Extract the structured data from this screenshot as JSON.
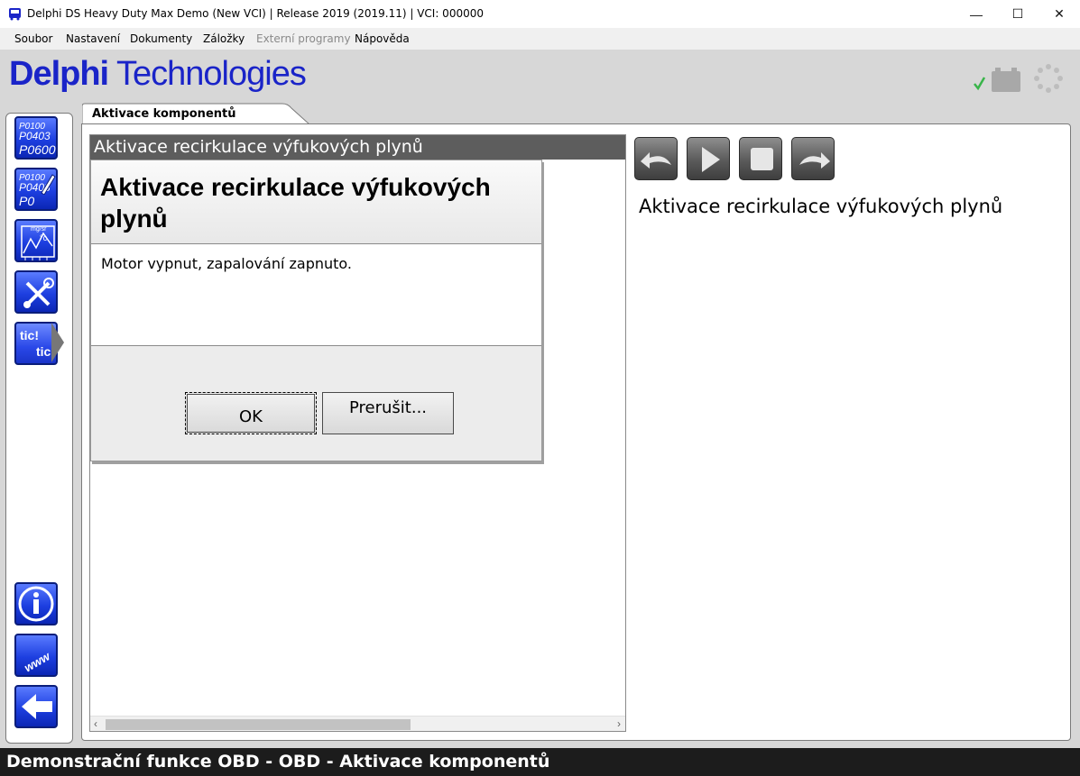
{
  "window": {
    "title": "Delphi DS Heavy Duty Max Demo (New VCI) | Release 2019 (2019.11)  |  VCI: 000000",
    "minimize_glyph": "—",
    "maximize_glyph": "☐",
    "close_glyph": "✕"
  },
  "menu": {
    "items": [
      "Soubor",
      "Nastavení",
      "Dokumenty",
      "Záložky",
      "Externí programy",
      "Nápověda"
    ]
  },
  "header": {
    "logo_part1": "Delphi",
    "logo_part2": "Technologies",
    "brand_color": "#1a24c8",
    "status_icons": [
      "checkmark-icon",
      "battery-icon",
      "loading-spinner-icon"
    ]
  },
  "sidebar": {
    "items": [
      {
        "name": "dtc-read",
        "lines": [
          "P0100",
          "P0403",
          "P0600"
        ]
      },
      {
        "name": "dtc-erase",
        "lines": [
          "P0100",
          "P0403",
          "P0"
        ]
      },
      {
        "name": "live-data",
        "lines": [
          "mg/sr",
          "°c"
        ]
      },
      {
        "name": "service-tools",
        "lines": []
      },
      {
        "name": "component-activation",
        "lines": [
          "tic!",
          "tic!"
        ]
      }
    ],
    "bottom_items": [
      "info",
      "www",
      "back"
    ]
  },
  "tab": {
    "label": "Aktivace komponentů"
  },
  "left_pane": {
    "header": "Aktivace recirkulace výfukových plynů"
  },
  "dialog": {
    "title": "Aktivace recirkulace výfukových plynů",
    "message": "Motor vypnut, zapalování zapnuto.",
    "ok_label": "OK",
    "abort_label": "Prerušit..."
  },
  "right_pane": {
    "title": "Aktivace recirkulace výfukových plynů"
  },
  "statusbar": {
    "text": "Demonstrační funkce OBD - OBD - Aktivace komponentů"
  }
}
